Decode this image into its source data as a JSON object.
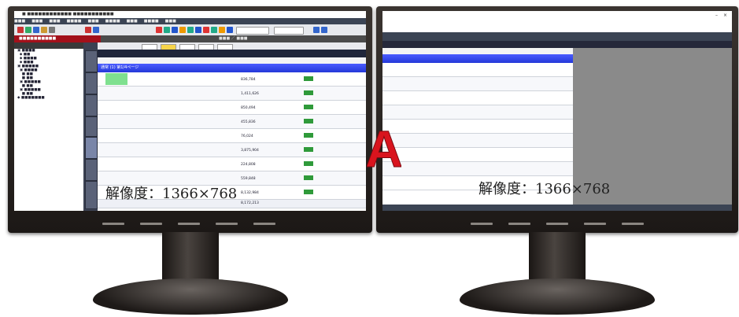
{
  "left_monitor": {
    "resolution_label": "解像度：1366×768",
    "screen": {
      "group_row_label": "通常 (1) 第1/4ページ",
      "total_row_value": "8,172,213",
      "rows": [
        {
          "amount": "836,784"
        },
        {
          "amount": "1,411,626"
        },
        {
          "amount": "850,494"
        },
        {
          "amount": "455,836"
        },
        {
          "amount": "76,024"
        },
        {
          "amount": "3,875,904"
        },
        {
          "amount": "224,808"
        },
        {
          "amount": "559,848"
        },
        {
          "amount": "8,132,984"
        }
      ]
    }
  },
  "right_monitor": {
    "resolution_label": "解像度：1366×768",
    "close_glyph": "×",
    "minimize_glyph": "–"
  },
  "center_mark": "A",
  "colors": {
    "accent_red": "#d9141e",
    "title_red": "#a3101a",
    "grid_blue": "#2438d8",
    "row_green": "#7fe08f"
  }
}
